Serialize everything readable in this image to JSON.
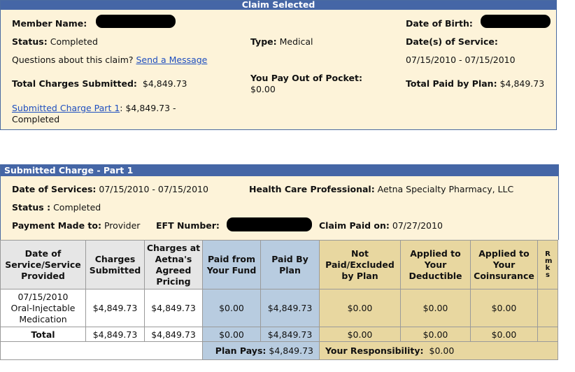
{
  "claim": {
    "header": "Claim Selected",
    "member_name_label": "Member Name:",
    "date_of_birth_label": "Date of Birth:",
    "status_label": "Status:",
    "status_value": "Completed",
    "type_label": "Type:",
    "type_value": "Medical",
    "dates_of_service_label": "Date(s) of Service:",
    "questions_text": "Questions about this claim?",
    "send_message_link": "Send a Message",
    "dates_of_service_value": "07/15/2010 - 07/15/2010",
    "total_charges_label": "Total Charges Submitted:",
    "total_charges_value": "$4,849.73",
    "you_pay_label": "You Pay Out of Pocket:",
    "you_pay_value": "$0.00",
    "total_paid_label": "Total Paid by Plan:",
    "total_paid_value": "$4,849.73",
    "charge_part_link": "Submitted Charge Part 1",
    "charge_part_amount": ": $4,849.73 -",
    "charge_part_status": "Completed"
  },
  "charge": {
    "header": "Submitted Charge - Part 1",
    "date_of_services_label": "Date of Services:",
    "date_of_services_value": "07/15/2010 - 07/15/2010",
    "hcp_label": "Health Care Professional:",
    "hcp_value": "Aetna Specialty Pharmacy, LLC",
    "status_label": "Status :",
    "status_value": "Completed",
    "payment_made_label": "Payment Made to:",
    "payment_made_value": "Provider",
    "eft_label": "EFT Number:",
    "claim_paid_label": "Claim Paid on:",
    "claim_paid_value": "07/27/2010"
  },
  "table": {
    "headers": {
      "date": "Date of Service/Service Provided",
      "charges": "Charges Submitted",
      "agreed": "Charges at Aetna's Agreed Pricing",
      "fund": "Paid from Your Fund",
      "plan": "Paid By Plan",
      "not_paid": "Not Paid/Excluded by Plan",
      "deductible": "Applied to Your Deductible",
      "coinsurance": "Applied to Your Coinsurance",
      "remarks": "Rmks"
    },
    "row": {
      "date": "07/15/2010",
      "service": "Oral-Injectable Medication",
      "charges": "$4,849.73",
      "agreed": "$4,849.73",
      "fund": "$0.00",
      "plan": "$4,849.73",
      "not_paid": "$0.00",
      "deductible": "$0.00",
      "coinsurance": "$0.00"
    },
    "total": {
      "label": "Total",
      "charges": "$4,849.73",
      "agreed": "$4,849.73",
      "fund": "$0.00",
      "plan": "$4,849.73",
      "not_paid": "$0.00",
      "deductible": "$0.00",
      "coinsurance": "$0.00"
    },
    "summary": {
      "plan_pays_label": "Plan Pays:",
      "plan_pays_value": "$4,849.73",
      "responsibility_label": "Your Responsibility:",
      "responsibility_value": "$0.00"
    }
  },
  "colors": {
    "header_blue": "#4566a6",
    "panel_tan": "#fdf3d9",
    "cell_blue": "#b8cce0",
    "cell_tan": "#e8d7a0",
    "cell_gray": "#e6e6e6",
    "link_blue": "#1f4fbf"
  }
}
